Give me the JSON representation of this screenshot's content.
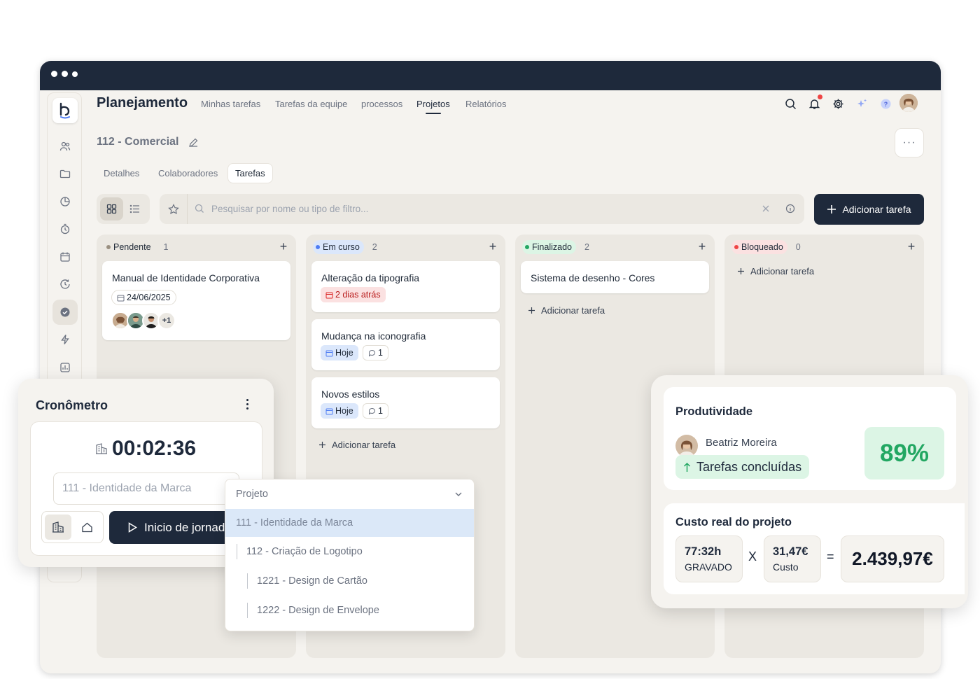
{
  "window": {
    "app_title": "Planejamento"
  },
  "nav": [
    {
      "label": "Minhas tarefas"
    },
    {
      "label": "Tarefas da equipe"
    },
    {
      "label": "processos"
    },
    {
      "label": "Projetos",
      "active": true
    },
    {
      "label": "Relatórios"
    }
  ],
  "header_icons": [
    "search-icon",
    "bell-icon",
    "gear-icon",
    "sparkle-icon",
    "help-icon",
    "user-avatar"
  ],
  "sidebar_icons": [
    "users-icon",
    "folder-icon",
    "pie-chart-icon",
    "stopwatch-icon",
    "calendar-icon",
    "clock-history-icon",
    "check-circle-icon",
    "lightning-icon",
    "chart-icon"
  ],
  "project": {
    "title": "112 - Comercial",
    "more_label": "···"
  },
  "tabs": [
    {
      "label": "Detalhes"
    },
    {
      "label": "Colaboradores"
    },
    {
      "label": "Tarefas",
      "active": true
    }
  ],
  "search": {
    "placeholder": "Pesquisar por nome ou tipo de filtro..."
  },
  "add_task_button": "Adicionar tarefa",
  "columns": [
    {
      "status": "Pendente",
      "count": "1",
      "color": "#9a8f80",
      "pill_bg": "#ebe8e2",
      "tasks": [
        {
          "title": "Manual de Identidade Corporativa",
          "date": "24/06/2025",
          "extra_avatars": "+1"
        }
      ]
    },
    {
      "status": "Em curso",
      "count": "2",
      "color": "#4f7df3",
      "pill_bg": "#dbe7fb",
      "tasks": [
        {
          "title": "Alteração da tipografia",
          "date": "2 dias atrás",
          "date_state": "overdue"
        },
        {
          "title": "Mudança na iconografia",
          "date": "Hoje",
          "comments": "1"
        },
        {
          "title": "Novos estilos",
          "date": "Hoje",
          "comments": "1"
        }
      ],
      "add_label": "Adicionar tarefa"
    },
    {
      "status": "Finalizado",
      "count": "2",
      "color": "#22a762",
      "pill_bg": "#dcf5e5",
      "tasks": [
        {
          "title": "Sistema de desenho - Cores"
        }
      ],
      "add_label": "Adicionar tarefa"
    },
    {
      "status": "Bloqueado",
      "count": "0",
      "color": "#ef4444",
      "pill_bg": "#fbe1e1",
      "tasks": [],
      "add_label": "Adicionar tarefa"
    }
  ],
  "chronometer": {
    "title": "Cronômetro",
    "time": "00:02:36",
    "project_value": "111 - Identidade da Marca",
    "start_label": "Inicio de jornada"
  },
  "dropdown": {
    "label": "Projeto",
    "options": [
      {
        "label": "111 - Identidade da Marca",
        "selected": true,
        "level": 0
      },
      {
        "label": "112 - Criação de Logotipo",
        "level": 1
      },
      {
        "label": "1221 - Design de Cartão",
        "level": 2
      },
      {
        "label": "1222 - Design de Envelope",
        "level": 2
      }
    ]
  },
  "productivity": {
    "title": "Produtividade",
    "user": "Beatriz Moreira",
    "badge": "Tarefas concluídas",
    "percent": "89%"
  },
  "cost": {
    "title": "Custo real do projeto",
    "hours": "77:32h",
    "hours_label": "GRAVADO",
    "times": "X",
    "rate": "31,47€",
    "rate_label": "Custo",
    "equals": "=",
    "total": "2.439,97€"
  },
  "colors": {
    "navy": "#1e293b",
    "green": "#22a762",
    "background": "#f5f3ef"
  }
}
